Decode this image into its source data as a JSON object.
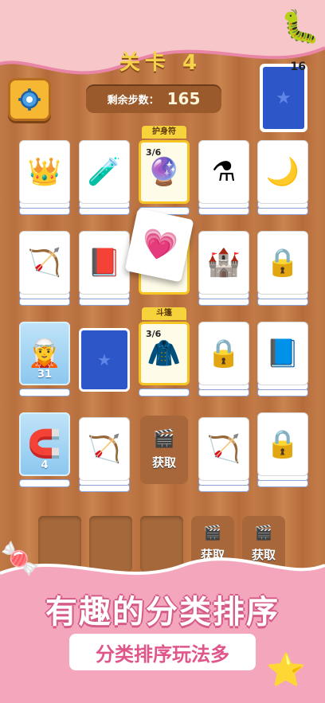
{
  "header": {
    "level_label": "关卡 4",
    "steps_label": "剩余步数：",
    "steps_value": "165",
    "deck_count": "16"
  },
  "grid": {
    "row1": [
      {
        "icon": "crown",
        "glyph": "👑"
      },
      {
        "icon": "potion-pink",
        "glyph": "🧪"
      },
      {
        "tag": "护身符",
        "fraction": "3/6",
        "icon": "amulet",
        "glyph": "🔮"
      },
      {
        "icon": "potion-blue",
        "glyph": "⚗"
      },
      {
        "icon": "moon-amulet",
        "glyph": "🌙"
      }
    ],
    "row2": [
      {
        "icon": "archer",
        "glyph": "🏹"
      },
      {
        "icon": "spellbook",
        "glyph": "📕"
      },
      {
        "icon": "heart-wings",
        "glyph": "💗"
      },
      {
        "icon": "castle",
        "glyph": "🏰"
      },
      {
        "icon": "locked-chain",
        "glyph": "🔒"
      }
    ],
    "row3": [
      {
        "icon": "frozen-archer",
        "glyph": "🧝",
        "ice_count": "31"
      },
      {
        "icon": "card-back",
        "glyph": "★"
      },
      {
        "tag": "斗篷",
        "fraction": "3/6",
        "icon": "cloak",
        "glyph": "🧥"
      },
      {
        "icon": "locked-chain-yellow",
        "glyph": "🔒"
      },
      {
        "icon": "winged-book",
        "glyph": "📘"
      }
    ],
    "row4": [
      {
        "icon": "frozen-horseshoe",
        "glyph": "🧲",
        "ice_count": "4"
      },
      {
        "icon": "archer-green",
        "glyph": "🏹"
      },
      {
        "video_label": "获取"
      },
      {
        "icon": "archer-orange",
        "glyph": "🏹"
      },
      {
        "icon": "locked-chain-blue",
        "glyph": "🔒"
      }
    ]
  },
  "tray": {
    "video_label_1": "获取",
    "video_label_2": "获取"
  },
  "promo": {
    "headline": "有趣的分类排序",
    "subline": "分类排序玩法多"
  },
  "colors": {
    "wood": "#c07a47",
    "gold": "#f5c623",
    "pink": "#f4a6bd",
    "blue": "#2d56c9"
  }
}
